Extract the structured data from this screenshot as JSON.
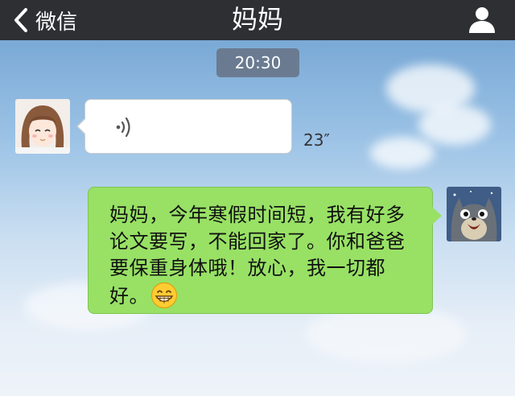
{
  "header": {
    "back_label": "微信",
    "title": "妈妈",
    "back_icon": "chevron-left-icon",
    "profile_icon": "person-icon"
  },
  "chat": {
    "timestamp": "20:30",
    "messages": [
      {
        "sender": "contact",
        "type": "voice",
        "duration": "23″",
        "avatar": "girl-avatar"
      },
      {
        "sender": "self",
        "type": "text",
        "text": "妈妈，今年寒假时间短，我有好多论文要写，不能回家了。你和爸爸要保重身体哦！放心，我一切都好。",
        "emoji": "grinning-face-emoji",
        "avatar": "totoro-avatar"
      }
    ]
  },
  "colors": {
    "header_bg": "#2e2f33",
    "self_bubble": "#98e165",
    "other_bubble": "#ffffff",
    "timestamp_bg": "#6a7b91"
  }
}
